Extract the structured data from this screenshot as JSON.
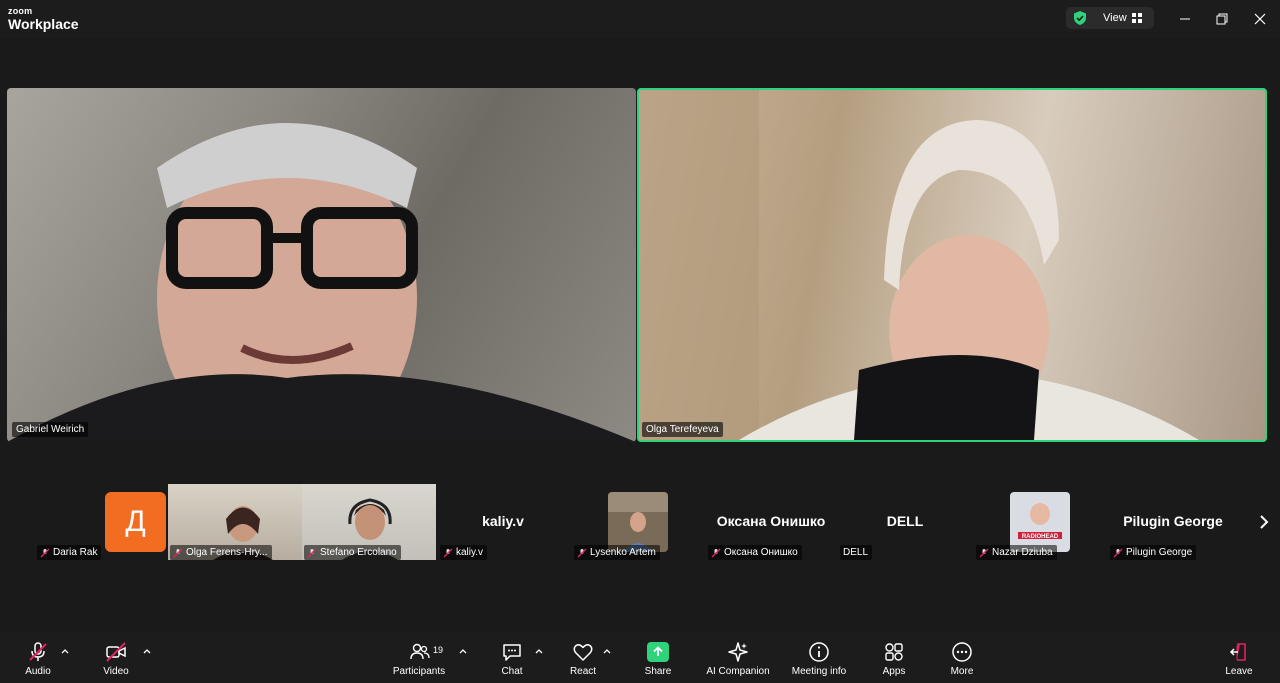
{
  "app": {
    "logo_top": "zoom",
    "logo_bottom": "Workplace"
  },
  "header": {
    "view_label": "View"
  },
  "main": {
    "speakers": [
      {
        "name": "Gabriel Weirich"
      },
      {
        "name": "Olga Terefeyeva"
      }
    ]
  },
  "thumbnails": [
    {
      "name": "Daria Rak",
      "avatar_letter": "Д",
      "avatar_color": "#f26d21"
    },
    {
      "name": "Olga Ferens-Hry..."
    },
    {
      "name": "Stefano Ercolano"
    },
    {
      "name": "kaliy.v",
      "display": "kaliy.v"
    },
    {
      "name": "Lysenko Artem"
    },
    {
      "name": "Оксана Онишко",
      "display": "Оксана Онишко"
    },
    {
      "name": "DELL",
      "display": "DELL"
    },
    {
      "name": "Nazar Dziuba",
      "photo_text": "RADIOHEAD"
    },
    {
      "name": "Pilugin George",
      "display": "Pilugin George"
    }
  ],
  "toolbar": {
    "audio": "Audio",
    "video": "Video",
    "participants": "Participants",
    "participants_count": "19",
    "chat": "Chat",
    "react": "React",
    "share": "Share",
    "ai_companion": "AI Companion",
    "meeting_info": "Meeting info",
    "apps": "Apps",
    "more": "More",
    "leave": "Leave"
  },
  "colors": {
    "active_speaker": "#2fd37c",
    "leave": "#e0245e",
    "muted": "#e0245e"
  }
}
